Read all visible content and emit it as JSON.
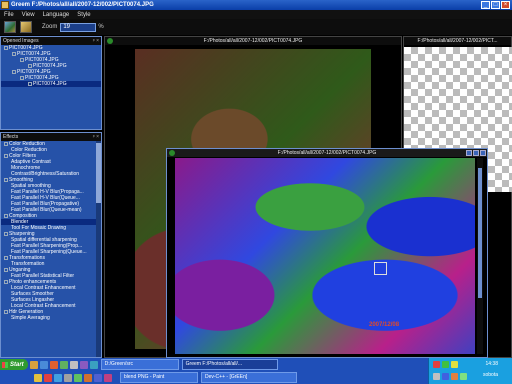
{
  "app": {
    "title": "Greem F:/Photos/all/all/2007-12/002/PICT0074.JPG",
    "window_buttons": [
      "_",
      "□",
      "×"
    ]
  },
  "menu": [
    "File",
    "View",
    "Language",
    "Style"
  ],
  "toolbar": {
    "zoom_label": "Zoom",
    "zoom_value": "19",
    "zoom_unit": "%"
  },
  "opened_panel": {
    "header": "Opened Images",
    "header_btns": "ᵖ ×",
    "items": [
      {
        "label": "PICT0074.JPG",
        "indent": 0,
        "selected": false
      },
      {
        "label": "PICT0074.JPG",
        "indent": 1,
        "selected": false
      },
      {
        "label": "PICT0074.JPG",
        "indent": 2,
        "selected": false
      },
      {
        "label": "PICT0074.JPG",
        "indent": 3,
        "selected": false
      },
      {
        "label": "PICT0074.JPG",
        "indent": 1,
        "selected": false
      },
      {
        "label": "PICT0074.JPG",
        "indent": 2,
        "selected": false
      },
      {
        "label": "PICT0074.JPG",
        "indent": 3,
        "selected": true
      }
    ]
  },
  "effects_panel": {
    "header": "Effects",
    "header_btns": "ᵖ ×",
    "items": [
      {
        "label": "Color Reduction",
        "cat": true
      },
      {
        "label": "Color Reduction",
        "cat": false
      },
      {
        "label": "Color Filters",
        "cat": true
      },
      {
        "label": "Adaptive Contrast",
        "cat": false
      },
      {
        "label": "Monochrome",
        "cat": false
      },
      {
        "label": "Contrast/Brightness/Saturation",
        "cat": false
      },
      {
        "label": "Smoothing",
        "cat": true
      },
      {
        "label": "Spatial smoothing",
        "cat": false
      },
      {
        "label": "Fast Parallel H-V Blur(Propaga...",
        "cat": false
      },
      {
        "label": "Fast Parallel H-V Blur(Queue...",
        "cat": false
      },
      {
        "label": "Fast Parallel Blur(Propagative)",
        "cat": false
      },
      {
        "label": "Fast Parallel Blur(Queue-mean)",
        "cat": false
      },
      {
        "label": "Composition",
        "cat": true
      },
      {
        "label": "Blender",
        "cat": false,
        "selected": true
      },
      {
        "label": "Tool For Mosaic Drawing",
        "cat": false
      },
      {
        "label": "Sharpening",
        "cat": true
      },
      {
        "label": "Spatial differential sharpening",
        "cat": false
      },
      {
        "label": "Fast Parallel Sharpening(Prop...",
        "cat": false
      },
      {
        "label": "Fast Parallel Sharpening(Queue...",
        "cat": false
      },
      {
        "label": "Transformations",
        "cat": true
      },
      {
        "label": "Transformation",
        "cat": false
      },
      {
        "label": "Unganing",
        "cat": true
      },
      {
        "label": "Fast Parallel Statistical Filter",
        "cat": false
      },
      {
        "label": "Photo enhancements",
        "cat": true
      },
      {
        "label": "Local Contrast Enhancement",
        "cat": false
      },
      {
        "label": "Surfaces Smoother",
        "cat": false
      },
      {
        "label": "Surfaces Lingasher",
        "cat": false
      },
      {
        "label": "Local Contrast Enhancement",
        "cat": false
      },
      {
        "label": "Hdr Generation",
        "cat": true
      },
      {
        "label": "Simple Averaging",
        "cat": false
      }
    ]
  },
  "image_windows": {
    "main_header": "F:/Photos/all/all/2007-12/002/PICT0074.JPG",
    "right_header": "F:/Photos/all/all/2007-12/002/PICT...",
    "front_header": "F:/Photos/all/all/2007-12/002/PICT0074.JPG",
    "date_stamp": "2007/12/08"
  },
  "taskbar": {
    "start_label": "Start",
    "row1": [
      {
        "label": "D:/Green/src",
        "active": false
      },
      {
        "label": "Greem F:/Photos/all/all/...",
        "active": true
      }
    ],
    "row2": [
      {
        "label": "blend PNG - Paint",
        "active": false
      },
      {
        "label": "Dev-C++ - [GrEEn]",
        "active": false
      }
    ],
    "clock": "14:38",
    "user": "sobota"
  }
}
